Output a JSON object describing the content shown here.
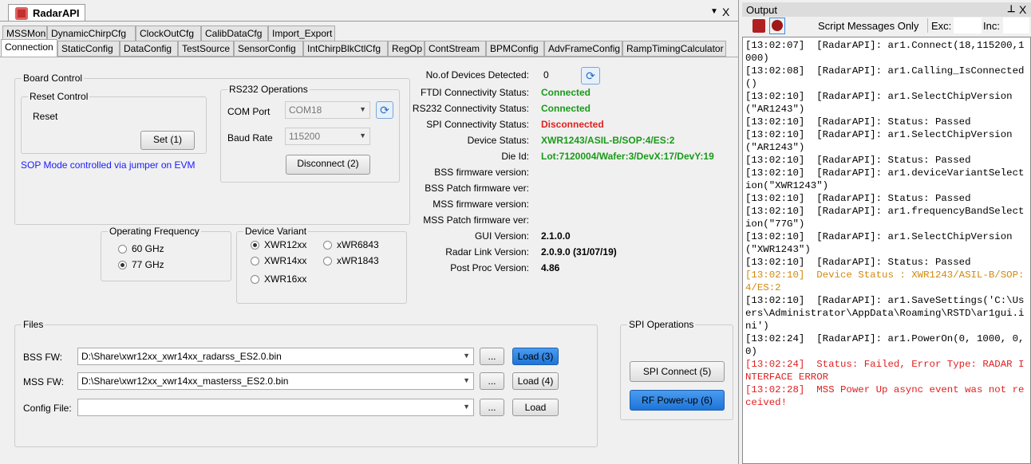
{
  "document": {
    "tab": "RadarAPI",
    "menu_arrow": "▼",
    "close": "X"
  },
  "tabs_row1": [
    "MSSMon",
    "DynamicChirpCfg",
    "ClockOutCfg",
    "CalibDataCfg",
    "Import_Export"
  ],
  "tabs_row2": [
    "Connection",
    "StaticConfig",
    "DataConfig",
    "TestSource",
    "SensorConfig",
    "IntChirpBlkCtlCfg",
    "RegOp",
    "ContStream",
    "BPMConfig",
    "AdvFrameConfig",
    "RampTimingCalculator"
  ],
  "board": {
    "title": "Board Control",
    "reset_group": "Reset Control",
    "reset_label": "Reset",
    "set_button": "Set (1)",
    "sop_note": "SOP Mode controlled via jumper on EVM"
  },
  "rs232": {
    "title": "RS232 Operations",
    "com_label": "COM Port",
    "com_value": "COM18",
    "baud_label": "Baud Rate",
    "baud_value": "115200",
    "disconnect": "Disconnect (2)"
  },
  "freq": {
    "title": "Operating Frequency",
    "options": [
      "60 GHz",
      "77 GHz"
    ],
    "selected": "77 GHz"
  },
  "variant": {
    "title": "Device Variant",
    "options": [
      "XWR12xx",
      "XWR14xx",
      "XWR16xx",
      "xWR6843",
      "xWR1843"
    ],
    "selected": "XWR12xx"
  },
  "status": {
    "devices_label": "No.of Devices Detected:",
    "devices_value": "0",
    "rows": [
      {
        "label": "FTDI Connectivity Status:",
        "value": "Connected",
        "color": "#1a9a1a"
      },
      {
        "label": "RS232 Connectivity Status:",
        "value": "Connected",
        "color": "#1a9a1a"
      },
      {
        "label": "SPI Connectivity Status:",
        "value": "Disconnected",
        "color": "#e02020"
      },
      {
        "label": "Device Status:",
        "value": "XWR1243/ASIL-B/SOP:4/ES:2",
        "color": "#1a9a1a"
      },
      {
        "label": "Die Id:",
        "value": "Lot:7120004/Wafer:3/DevX:17/DevY:19",
        "color": "#1a9a1a"
      },
      {
        "label": "BSS firmware version:",
        "value": "",
        "color": "#000"
      },
      {
        "label": "BSS Patch firmware ver:",
        "value": "",
        "color": "#000"
      },
      {
        "label": "MSS firmware version:",
        "value": "",
        "color": "#000"
      },
      {
        "label": "MSS Patch firmware ver:",
        "value": "",
        "color": "#000"
      },
      {
        "label": "GUI Version:",
        "value": "2.1.0.0",
        "color": "#000"
      },
      {
        "label": "Radar Link Version:",
        "value": "2.0.9.0 (31/07/19)",
        "color": "#000"
      },
      {
        "label": "Post Proc Version:",
        "value": "4.86",
        "color": "#000"
      }
    ]
  },
  "files": {
    "title": "Files",
    "rows": [
      {
        "label": "BSS FW:",
        "value": "D:\\Share\\xwr12xx_xwr14xx_radarss_ES2.0.bin",
        "browse": "...",
        "load": "Load (3)"
      },
      {
        "label": "MSS FW:",
        "value": "D:\\Share\\xwr12xx_xwr14xx_masterss_ES2.0.bin",
        "browse": "...",
        "load": "Load (4)"
      },
      {
        "label": "Config File:",
        "value": "",
        "browse": "...",
        "load": "Load"
      }
    ]
  },
  "spi": {
    "title": "SPI Operations",
    "connect": "SPI Connect (5)",
    "rf_powerup": "RF Power-up (6)"
  },
  "output": {
    "title": "Output",
    "pin": "⊥",
    "close": "X",
    "filter": "Script Messages Only",
    "exc": "Exc:",
    "inc": "Inc:",
    "log": [
      {
        "t": "[13:02:07]  [RadarAPI]: ar1.Connect(18,115200,1000)",
        "c": ""
      },
      {
        "t": "[13:02:08]  [RadarAPI]: ar1.Calling_IsConnected()",
        "c": ""
      },
      {
        "t": "[13:02:10]  [RadarAPI]: ar1.SelectChipVersion(\"AR1243\")",
        "c": ""
      },
      {
        "t": "[13:02:10]  [RadarAPI]: Status: Passed",
        "c": ""
      },
      {
        "t": "[13:02:10]  [RadarAPI]: ar1.SelectChipVersion(\"AR1243\")",
        "c": ""
      },
      {
        "t": "[13:02:10]  [RadarAPI]: Status: Passed",
        "c": ""
      },
      {
        "t": "[13:02:10]  [RadarAPI]: ar1.deviceVariantSelection(\"XWR1243\")",
        "c": ""
      },
      {
        "t": "[13:02:10]  [RadarAPI]: Status: Passed",
        "c": ""
      },
      {
        "t": "[13:02:10]  [RadarAPI]: ar1.frequencyBandSelection(\"77G\")",
        "c": ""
      },
      {
        "t": "[13:02:10]  [RadarAPI]: ar1.SelectChipVersion(\"XWR1243\")",
        "c": ""
      },
      {
        "t": "[13:02:10]  [RadarAPI]: Status: Passed",
        "c": ""
      },
      {
        "t": "[13:02:10]  Device Status : XWR1243/ASIL-B/SOP:4/ES:2",
        "c": "l-orange"
      },
      {
        "t": "[13:02:10]  [RadarAPI]: ar1.SaveSettings('C:\\Users\\Administrator\\AppData\\Roaming\\RSTD\\ar1gui.ini')",
        "c": ""
      },
      {
        "t": "[13:02:24]  [RadarAPI]: ar1.PowerOn(0, 1000, 0, 0)",
        "c": ""
      },
      {
        "t": "[13:02:24]  Status: Failed, Error Type: RADAR INTERFACE ERROR",
        "c": "l-red"
      },
      {
        "t": "[13:02:28]  MSS Power Up async event was not received!",
        "c": "l-red"
      }
    ]
  }
}
